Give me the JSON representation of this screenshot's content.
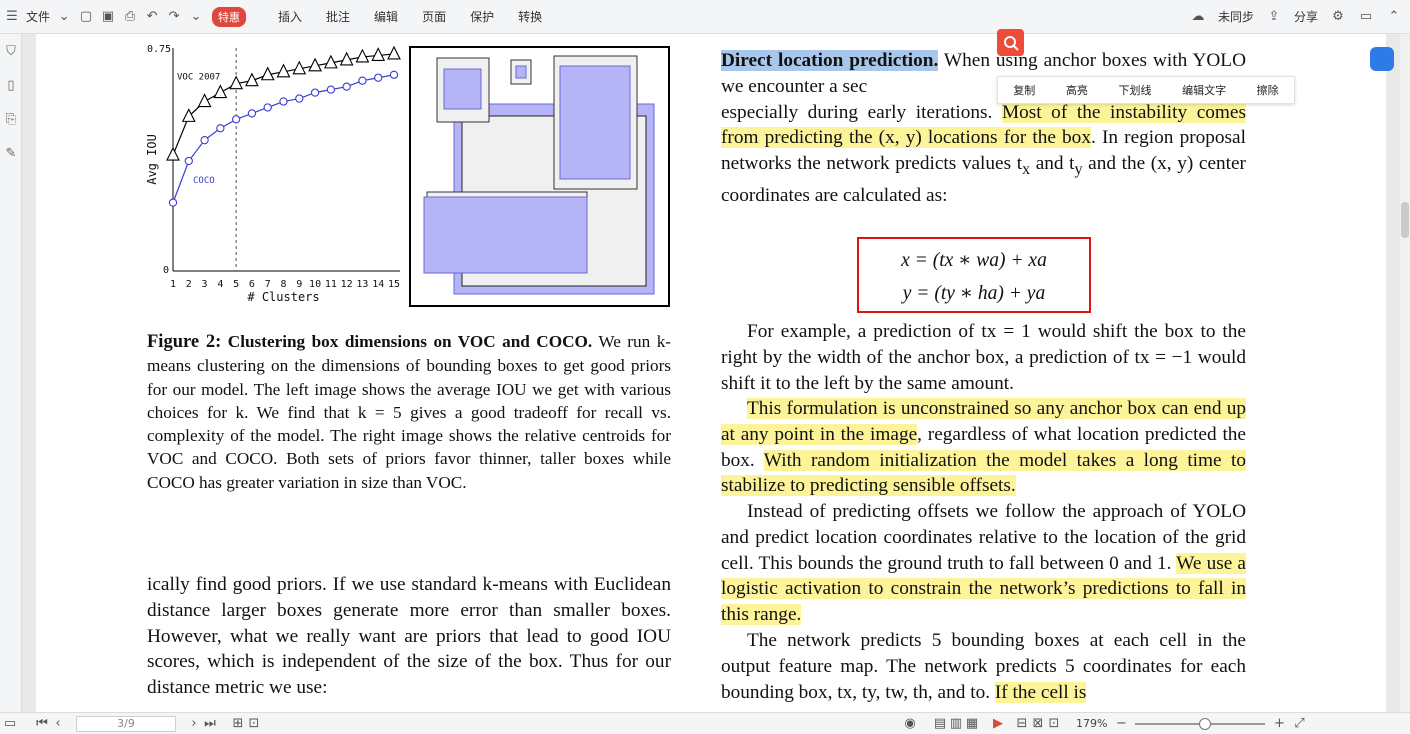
{
  "toolbar": {
    "file_label": "文件",
    "brand": "特惠",
    "menu": [
      "插入",
      "批注",
      "编辑",
      "页面",
      "保护",
      "转换"
    ],
    "sync": "未同步",
    "share": "分享"
  },
  "context_menu": [
    "复制",
    "高亮",
    "下划线",
    "编辑文字",
    "擦除"
  ],
  "footer": {
    "page_input": "3/9",
    "zoom": "179%"
  },
  "figure": {
    "left_chart": {
      "ylabel": "Avg IOU",
      "xlabel": "# Clusters",
      "ytick_top": "0.75",
      "ytick_bottom": "0",
      "voc_label": "VOC 2007",
      "coco_label": "COCO",
      "xticks": [
        "1",
        "2",
        "3",
        "4",
        "5",
        "6",
        "7",
        "8",
        "9",
        "10",
        "11",
        "12",
        "13",
        "14",
        "15"
      ]
    },
    "caption_bold": "Figure 2:",
    "caption_title": "Clustering box dimensions on VOC and COCO.",
    "caption_text": "We run k-means clustering on the dimensions of bounding boxes to get good priors for our model. The left image shows the average IOU we get with various choices for k. We find that k = 5 gives a good tradeoff for recall vs. complexity of the model. The right image shows the relative centroids for VOC and COCO. Both sets of priors favor thinner, taller boxes while COCO has greater variation in size than VOC."
  },
  "chart_data": {
    "type": "line",
    "xlabel": "# Clusters",
    "ylabel": "Avg IOU",
    "x": [
      1,
      2,
      3,
      4,
      5,
      6,
      7,
      8,
      9,
      10,
      11,
      12,
      13,
      14,
      15
    ],
    "ylim": [
      0,
      0.75
    ],
    "series": [
      {
        "name": "VOC 2007",
        "values": [
          0.39,
          0.52,
          0.57,
          0.6,
          0.63,
          0.64,
          0.66,
          0.67,
          0.68,
          0.69,
          0.7,
          0.71,
          0.72,
          0.725,
          0.73
        ]
      },
      {
        "name": "COCO",
        "values": [
          0.23,
          0.37,
          0.44,
          0.48,
          0.51,
          0.53,
          0.55,
          0.57,
          0.58,
          0.6,
          0.61,
          0.62,
          0.64,
          0.65,
          0.66
        ]
      }
    ],
    "vline_x": 5
  },
  "left_body": "ically find good priors. If we use standard k-means with Euclidean distance larger boxes generate more error than smaller boxes. However, what we really want are priors that lead to good IOU scores, which is independent of the size of the box. Thus for our distance metric we use:",
  "right_col": {
    "heading": "Direct location prediction.",
    "p1_rest": " When using anchor boxes with YOLO we encounter a sec",
    "p1_b": "especially during early iterations. ",
    "p1_hl": "Most of the instability comes from predicting the (x, y) locations for the box",
    "p1_c": ". In region proposal networks the network predicts values t",
    "p1_tx": "x",
    "p1_and": " and t",
    "p1_ty": "y",
    "p1_end": " and the (x, y) center coordinates are calculated as:",
    "eq1": "x = (tx ∗ wa) + xa",
    "eq2": "y = (ty ∗ ha) + ya",
    "p2": "For example, a prediction of tx = 1 would shift the box to the right by the width of the anchor box, a prediction of tx = −1 would shift it to the left by the same amount.",
    "p3_hl": "This formulation is unconstrained so any anchor box can end up at any point in the image",
    "p3_mid": ", regardless of what location predicted the box. ",
    "p3_hl2": "With random initialization the model takes a long time to stabilize to predicting sensible offsets.",
    "p4": "Instead of predicting offsets we follow the approach of YOLO and predict location coordinates relative to the location of the grid cell. This bounds the ground truth to fall between 0 and 1. ",
    "p4_hl": "We use a logistic activation to constrain the network’s predictions to fall in this range.",
    "p5": "The network predicts 5 bounding boxes at each cell in the output feature map. The network predicts 5 coordinates for each bounding box, tx, ty, tw, th, and to. ",
    "p5_hl": "If the cell is"
  }
}
